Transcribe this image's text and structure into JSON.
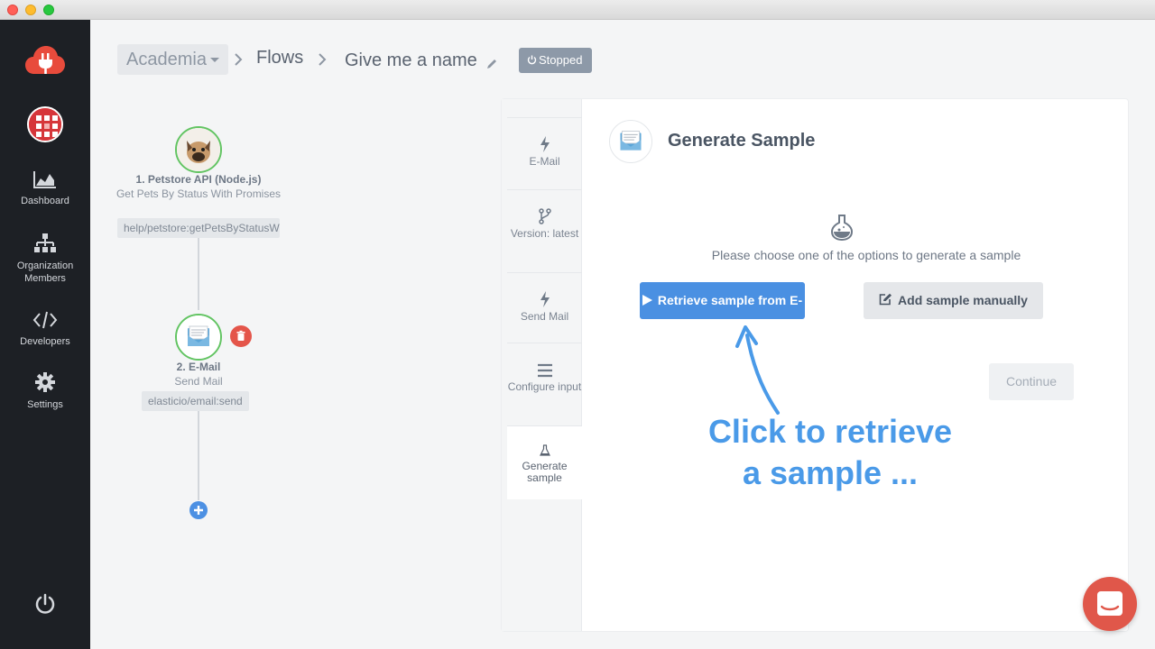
{
  "window": {
    "traffic_lights": [
      "close",
      "minimize",
      "zoom"
    ]
  },
  "sidebar": {
    "logo": "plug-cloud-icon",
    "items": [
      {
        "label": "Dashboard",
        "icon": "area-chart-icon"
      },
      {
        "label": "Organization\nMembers",
        "icon": "org-chart-icon"
      },
      {
        "label": "Developers",
        "icon": "code-icon"
      },
      {
        "label": "Settings",
        "icon": "gear-icon"
      }
    ],
    "logout_icon": "power-icon"
  },
  "breadcrumb": {
    "workspace": "Academia",
    "section": "Flows",
    "flow_name": "Give me a name",
    "status": "Stopped"
  },
  "flow": {
    "steps": [
      {
        "title": "1. Petstore API (Node.js)",
        "subtitle": "Get Pets By Status With Promises",
        "tag": "help/petstore:getPetsByStatusWithPromises"
      },
      {
        "title": "2. E-Mail",
        "subtitle": "Send Mail",
        "tag": "elasticio/email:send"
      }
    ]
  },
  "panel": {
    "tabs": [
      {
        "label": "E-Mail",
        "icon": "bolt-icon"
      },
      {
        "label": "Version: latest",
        "icon": "branch-icon"
      },
      {
        "label": "Send Mail",
        "icon": "bolt-icon"
      },
      {
        "label": "Configure input",
        "icon": "bars-icon"
      },
      {
        "label": "Generate sample",
        "icon": "flask-icon"
      }
    ],
    "title": "Generate Sample",
    "hint": "Please choose one of the options to generate a sample",
    "retrieve_label": "Retrieve sample from E-Mail",
    "manual_label": "Add sample manually",
    "continue_label": "Continue"
  },
  "annotation": {
    "line1": "Click to retrieve",
    "line2": "a sample ..."
  },
  "colors": {
    "sidebar_bg": "#1d2025",
    "primary": "#4a90e2",
    "annotation": "#4a9ae8",
    "danger": "#e4554a",
    "success_ring": "#62c462",
    "chat": "#e0574a"
  }
}
